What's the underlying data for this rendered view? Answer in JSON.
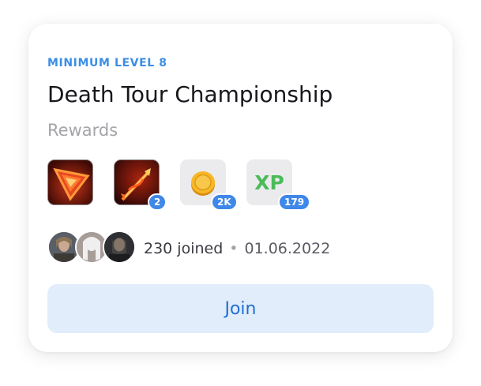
{
  "card": {
    "level_label": "MINIMUM LEVEL 8",
    "title": "Death Tour Championship",
    "rewards_label": "Rewards"
  },
  "rewards": [
    {
      "icon": "red-triangle-gem-icon",
      "count": ""
    },
    {
      "icon": "fire-arrow-icon",
      "count": "2"
    },
    {
      "icon": "gold-coin-icon",
      "count": "2K"
    },
    {
      "icon": "xp-icon",
      "label": "XP",
      "count": "179"
    }
  ],
  "participants": {
    "avatars": [
      "participant-avatar-1",
      "participant-avatar-2",
      "participant-avatar-3"
    ],
    "joined_text": "230 joined",
    "separator": "•",
    "date": "01.06.2022"
  },
  "join_button": {
    "label": "Join"
  },
  "colors": {
    "accent": "#3a8ee6",
    "badge": "#3f87e8",
    "join_bg": "#e2edfb",
    "join_text": "#1f6fd1",
    "xp_green": "#4cbb5a"
  }
}
